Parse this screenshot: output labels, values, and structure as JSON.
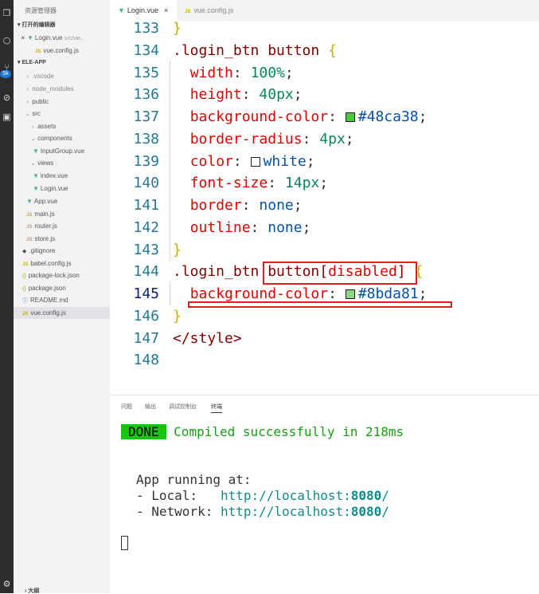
{
  "explorer": {
    "title": "资源管理器",
    "open_editors_label": "打开的编辑器",
    "open_editors": [
      {
        "name": "Login.vue",
        "hint": "src/vie..."
      },
      {
        "name": "vue.config.js"
      }
    ],
    "project_label": "ELE-APP",
    "tree": [
      {
        "name": ".vscode"
      },
      {
        "name": "node_modules"
      },
      {
        "name": "public"
      },
      {
        "name": "src"
      },
      {
        "name": "assets"
      },
      {
        "name": "components"
      },
      {
        "name": "InputGroup.vue"
      },
      {
        "name": "views"
      },
      {
        "name": "index.vue"
      },
      {
        "name": "Login.vue"
      },
      {
        "name": "App.vue"
      },
      {
        "name": "main.js"
      },
      {
        "name": "router.js"
      },
      {
        "name": "store.js"
      },
      {
        "name": ".gitignore"
      },
      {
        "name": "babel.config.js"
      },
      {
        "name": "package-lock.json"
      },
      {
        "name": "package.json"
      },
      {
        "name": "README.md"
      },
      {
        "name": "vue.config.js"
      }
    ],
    "bottom_label": "大纲"
  },
  "activity": {
    "badge": "5k"
  },
  "tabs": [
    {
      "label": "Login.vue",
      "close": "×"
    },
    {
      "label": "vue.config.js"
    }
  ],
  "icons": {
    "vue": "vue-icon",
    "js": "js-icon",
    "close": "close-icon",
    "folder_closed": "chevron-right-icon",
    "folder_open": "chevron-down-icon"
  },
  "colors": {
    "swatch_green": "#48ca38",
    "swatch_white": "#ffffff",
    "swatch_light_green": "#8bda81",
    "highlight": "#e02020"
  },
  "editor": {
    "line_numbers": [
      "133",
      "134",
      "135",
      "136",
      "137",
      "138",
      "139",
      "140",
      "141",
      "142",
      "143",
      "144",
      "145",
      "146",
      "147",
      "148"
    ],
    "l133": "}",
    "l134_sel": ".login_btn button",
    "l134_brace": "{",
    "props": {
      "width": "width",
      "width_val": "100%",
      "height": "height",
      "height_val": "40px",
      "bg": "background-color",
      "bg_val": "#48ca38",
      "radius": "border-radius",
      "radius_val": "4px",
      "color": "color",
      "color_val": "white",
      "fsize": "font-size",
      "fsize_val": "14px",
      "border": "border",
      "border_val": "none",
      "outline": "outline",
      "outline_val": "none"
    },
    "l143": "}",
    "l144_sel1": ".login_btn",
    "l144_sel2": "button",
    "l144_open": "[",
    "l144_attr": "disabled",
    "l144_close": "]",
    "l144_brace": "{",
    "l145_prop": "background-color",
    "l145_val": "#8bda81",
    "l146": "}",
    "l147": "</style>"
  },
  "panel": {
    "tabs": [
      "问题",
      "输出",
      "调试控制台",
      "终端"
    ],
    "done": "DONE",
    "compiled": "Compiled successfully in 218ms",
    "running": "App running at:",
    "local_label": "- Local:   ",
    "local_url": "http://localhost:",
    "local_port": "8080",
    "network_label": "- Network: ",
    "network_url": "http://localhost:",
    "network_port": "8080",
    "slash": "/"
  }
}
